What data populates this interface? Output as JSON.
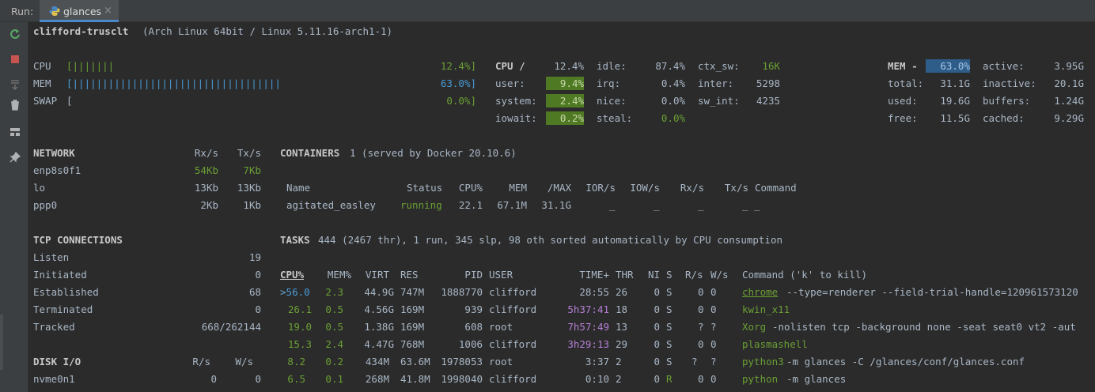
{
  "toolbar": {
    "run_label": "Run:",
    "tab_label": "glances",
    "close": "×"
  },
  "left_tools": [
    "rerun-icon",
    "stop-icon",
    "scroll-to-end-icon",
    "trash-icon",
    "layout-icon",
    "pin-icon"
  ],
  "header": {
    "host": "clifford-trusclt",
    "os": "(Arch Linux 64bit / Linux 5.11.16-arch1-1)"
  },
  "quicklook": {
    "cpu": {
      "label": "CPU",
      "bar": "[|||||||",
      "value": "12.4%]",
      "pct": 12.4
    },
    "mem": {
      "label": "MEM",
      "bar": "[|||||||||||||||||||||||||||||||||||",
      "value": "63.0%]",
      "pct": 63.0
    },
    "swap": {
      "label": "SWAP",
      "bar": "[",
      "value": "0.0%]",
      "pct": 0.0
    }
  },
  "cpu": {
    "title": "CPU /",
    "total": "12.4%",
    "user_l": "user:",
    "user_v": "9.4%",
    "system_l": "system:",
    "system_v": "2.4%",
    "iowait_l": "iowait:",
    "iowait_v": "0.2%",
    "idle_l": "idle:",
    "idle_v": "87.4%",
    "irq_l": "irq:",
    "irq_v": "0.4%",
    "nice_l": "nice:",
    "nice_v": "0.0%",
    "steal_l": "steal:",
    "steal_v": "0.0%",
    "ctx_l": "ctx_sw:",
    "ctx_v": "16K",
    "inter_l": "inter:",
    "inter_v": "5298",
    "swint_l": "sw_int:",
    "swint_v": "4235"
  },
  "mem": {
    "title": "MEM -",
    "pct": "63.0%",
    "total_l": "total:",
    "total_v": "31.1G",
    "used_l": "used:",
    "used_v": "19.6G",
    "free_l": "free:",
    "free_v": "11.5G",
    "active_l": "active:",
    "active_v": "3.95G",
    "inactive_l": "inactive:",
    "inactive_v": "20.1G",
    "buffers_l": "buffers:",
    "buffers_v": "1.24G",
    "cached_l": "cached:",
    "cached_v": "9.29G"
  },
  "network": {
    "title": "NETWORK",
    "rx_h": "Rx/s",
    "tx_h": "Tx/s",
    "rows": [
      {
        "name": "enp8s0f1",
        "rx": "54Kb",
        "tx": "7Kb"
      },
      {
        "name": "lo",
        "rx": "13Kb",
        "tx": "13Kb"
      },
      {
        "name": "ppp0",
        "rx": "2Kb",
        "tx": "1Kb"
      }
    ]
  },
  "containers": {
    "title": "CONTAINERS",
    "summary": "1 (served by Docker 20.10.6)",
    "headers": {
      "name": "Name",
      "status": "Status",
      "cpu": "CPU%",
      "mem": "MEM",
      "max": "/MAX",
      "ior": "IOR/s",
      "iow": "IOW/s",
      "rx": "Rx/s",
      "tx": "Tx/s",
      "cmd": "Command"
    },
    "row": {
      "name": "agitated_easley",
      "status": "running",
      "cpu": "22.1",
      "mem": "67.1M",
      "max": "31.1G",
      "ior": "_",
      "iow": "_",
      "rx": "_",
      "tx": "_",
      "cmd": "_ _"
    }
  },
  "tcp": {
    "title": "TCP CONNECTIONS",
    "rows": [
      {
        "label": "Listen",
        "value": "19"
      },
      {
        "label": "Initiated",
        "value": "0"
      },
      {
        "label": "Established",
        "value": "68"
      },
      {
        "label": "Terminated",
        "value": "0"
      },
      {
        "label": "Tracked",
        "value": "668/262144"
      }
    ]
  },
  "tasks": {
    "title": "TASKS",
    "summary": "444 (2467 thr), 1 run, 345 slp, 98 oth sorted automatically by CPU consumption",
    "headers": {
      "cpu": "CPU%",
      "mem": "MEM%",
      "virt": "VIRT",
      "res": "RES",
      "pid": "PID",
      "user": "USER",
      "time": "TIME+",
      "thr": "THR",
      "ni": "NI",
      "s": "S",
      "rs": "R/s",
      "ws": "W/s",
      "cmd": "Command ('k' to kill)"
    },
    "rows": [
      {
        "cpu": ">56.0",
        "mem": "2.3",
        "virt": "44.9G",
        "res": "747M",
        "pid": "1888770",
        "user": "clifford",
        "time": "28:55",
        "thr": "26",
        "ni": "0",
        "s": "S",
        "rs": "0",
        "ws": "0",
        "cmd": "chrome",
        "args": "--type=renderer --field-trial-handle=120961573120"
      },
      {
        "cpu": "26.1",
        "mem": "0.5",
        "virt": "4.56G",
        "res": "169M",
        "pid": "939",
        "user": "clifford",
        "time": "5h37:41",
        "thr": "18",
        "ni": "0",
        "s": "S",
        "rs": "0",
        "ws": "0",
        "cmd": "kwin_x11",
        "args": ""
      },
      {
        "cpu": "19.0",
        "mem": "0.5",
        "virt": "1.38G",
        "res": "169M",
        "pid": "608",
        "user": "root",
        "time": "7h57:49",
        "thr": "13",
        "ni": "0",
        "s": "S",
        "rs": "?",
        "ws": "?",
        "cmd": "Xorg",
        "args": "-nolisten tcp -background none -seat seat0 vt2 -aut"
      },
      {
        "cpu": "15.3",
        "mem": "2.4",
        "virt": "4.47G",
        "res": "768M",
        "pid": "1006",
        "user": "clifford",
        "time": "3h29:13",
        "thr": "29",
        "ni": "0",
        "s": "S",
        "rs": "0",
        "ws": "0",
        "cmd": "plasmashell",
        "args": ""
      },
      {
        "cpu": "8.2",
        "mem": "0.2",
        "virt": "434M",
        "res": "63.6M",
        "pid": "1978053",
        "user": "root",
        "time": "3:37",
        "thr": "2",
        "ni": "0",
        "s": "S",
        "rs": "?",
        "ws": "?",
        "cmd": "python3",
        "args": "-m glances -C /glances/conf/glances.conf"
      },
      {
        "cpu": "6.5",
        "mem": "0.1",
        "virt": "268M",
        "res": "41.8M",
        "pid": "1998040",
        "user": "clifford",
        "time": "0:10",
        "thr": "2",
        "ni": "0",
        "s": "R",
        "rs": "0",
        "ws": "0",
        "cmd": "python",
        "args": "-m glances"
      }
    ]
  },
  "disk": {
    "title": "DISK I/O",
    "r_h": "R/s",
    "w_h": "W/s",
    "rows": [
      {
        "name": "nvme0n1",
        "r": "0",
        "w": "0"
      }
    ]
  }
}
